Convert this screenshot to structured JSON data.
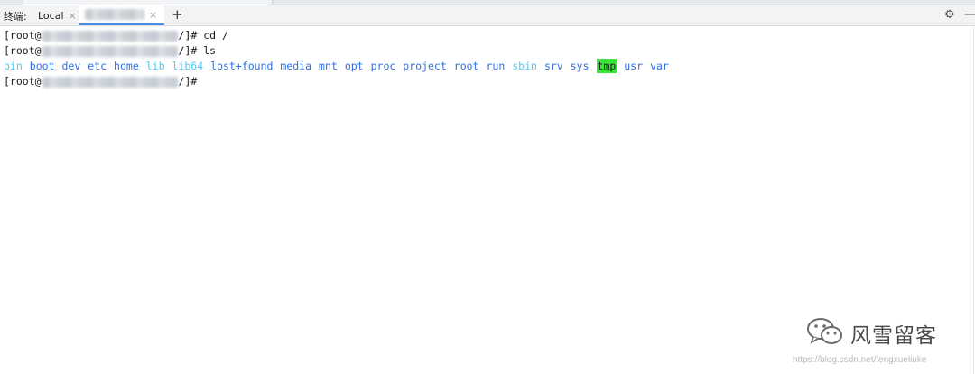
{
  "toolwindow": {
    "title": "终端:",
    "tabs": [
      {
        "label": "Local",
        "close": "×"
      },
      {
        "label": "",
        "close": "×"
      }
    ],
    "add_icon": "+",
    "settings_icon": "⚙",
    "minimize_icon": "—"
  },
  "terminal": {
    "lines": [
      {
        "prefix": "[root@",
        "suffix": "/]# cd /"
      },
      {
        "prefix": "[root@",
        "suffix": "/]# ls"
      },
      {
        "prefix": "[root@",
        "suffix": "/]#"
      }
    ],
    "ls_entries": [
      {
        "name": "bin",
        "kind": "link"
      },
      {
        "name": "boot",
        "kind": "dir"
      },
      {
        "name": "dev",
        "kind": "dir"
      },
      {
        "name": "etc",
        "kind": "dir"
      },
      {
        "name": "home",
        "kind": "dir"
      },
      {
        "name": "lib",
        "kind": "link"
      },
      {
        "name": "lib64",
        "kind": "link"
      },
      {
        "name": "lost+found",
        "kind": "dir"
      },
      {
        "name": "media",
        "kind": "dir"
      },
      {
        "name": "mnt",
        "kind": "dir"
      },
      {
        "name": "opt",
        "kind": "dir"
      },
      {
        "name": "proc",
        "kind": "dir"
      },
      {
        "name": "project",
        "kind": "dir"
      },
      {
        "name": "root",
        "kind": "dir"
      },
      {
        "name": "run",
        "kind": "dir"
      },
      {
        "name": "sbin",
        "kind": "link"
      },
      {
        "name": "srv",
        "kind": "dir"
      },
      {
        "name": "sys",
        "kind": "dir"
      },
      {
        "name": "tmp",
        "kind": "sticky"
      },
      {
        "name": "usr",
        "kind": "dir"
      },
      {
        "name": "var",
        "kind": "dir"
      }
    ],
    "colors": {
      "link": "#4ec9f0",
      "dir": "#2f6fe0",
      "sticky_bg": "#39e639"
    }
  },
  "watermark": {
    "brand": "风雪留客",
    "url": "https://blog.csdn.net/fengxueliuke"
  }
}
